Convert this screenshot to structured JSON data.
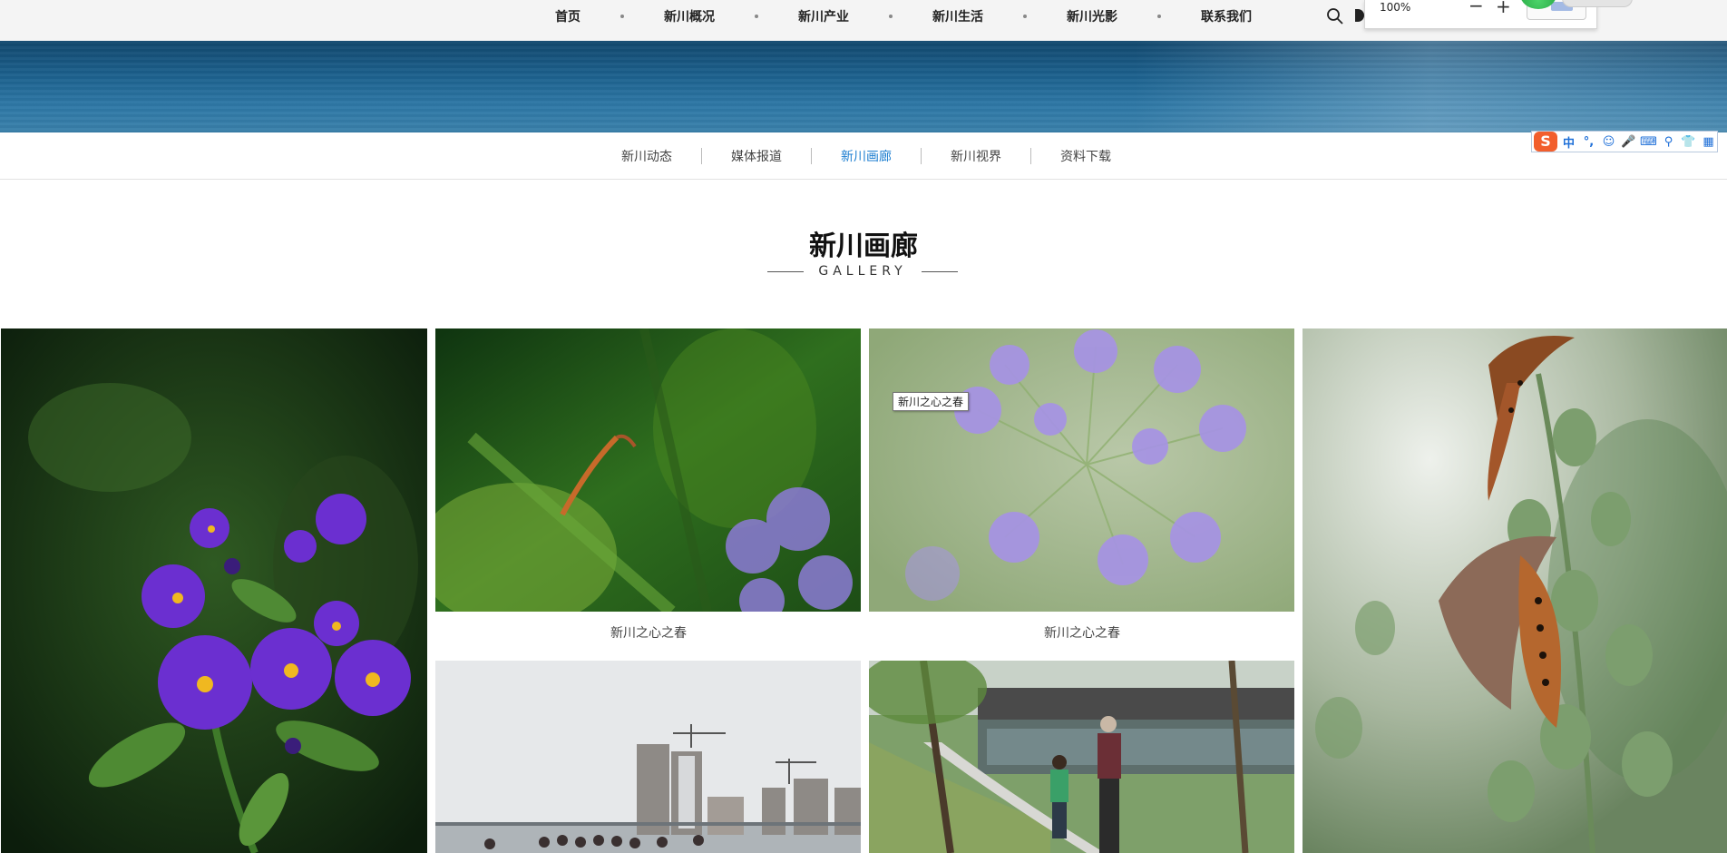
{
  "topnav": {
    "items": [
      "首页",
      "新川概况",
      "新川产业",
      "新川生活",
      "新川光影",
      "联系我们"
    ]
  },
  "zoom": {
    "value": "100%",
    "minus": "−",
    "plus": "+"
  },
  "subnav": {
    "items": [
      "新川动态",
      "媒体报道",
      "新川画廊",
      "新川视界",
      "资料下载"
    ],
    "active": "新川画廊"
  },
  "ime": {
    "logo": "S",
    "glyphs": [
      "中",
      "°,",
      "☺",
      "🎤",
      "⌨",
      "⚲",
      "👕",
      "▦"
    ]
  },
  "gallery": {
    "title": "新川画廊",
    "subtitle": "GALLERY",
    "captions": [
      "新川之心之春",
      "新川之心之春"
    ],
    "tooltip": "新川之心之春"
  },
  "colors": {
    "accent": "#1c7ed0",
    "banner": "#1d628f"
  }
}
